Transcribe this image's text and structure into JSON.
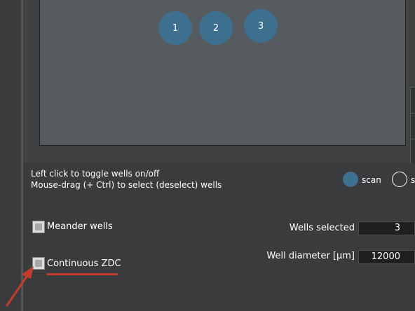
{
  "plate": {
    "wells": [
      {
        "label": "1"
      },
      {
        "label": "2"
      },
      {
        "label": "3"
      }
    ]
  },
  "instructions": {
    "line1": "Left click to toggle wells on/off",
    "line2": "Mouse-drag (+ Ctrl)  to select (deselect) wells"
  },
  "mode": {
    "scan_label": "scan",
    "second_label": "s",
    "selected": "scan"
  },
  "options": {
    "meander_wells_label": "Meander wells",
    "continuous_zdc_label": "Continuous ZDC"
  },
  "fields": {
    "wells_selected_label": "Wells selected",
    "wells_selected_value": "3",
    "well_diameter_label": "Well diameter [µm]",
    "well_diameter_value": "12000"
  },
  "colors": {
    "well_fill": "#3c708e",
    "annotation": "#c53a2f"
  }
}
